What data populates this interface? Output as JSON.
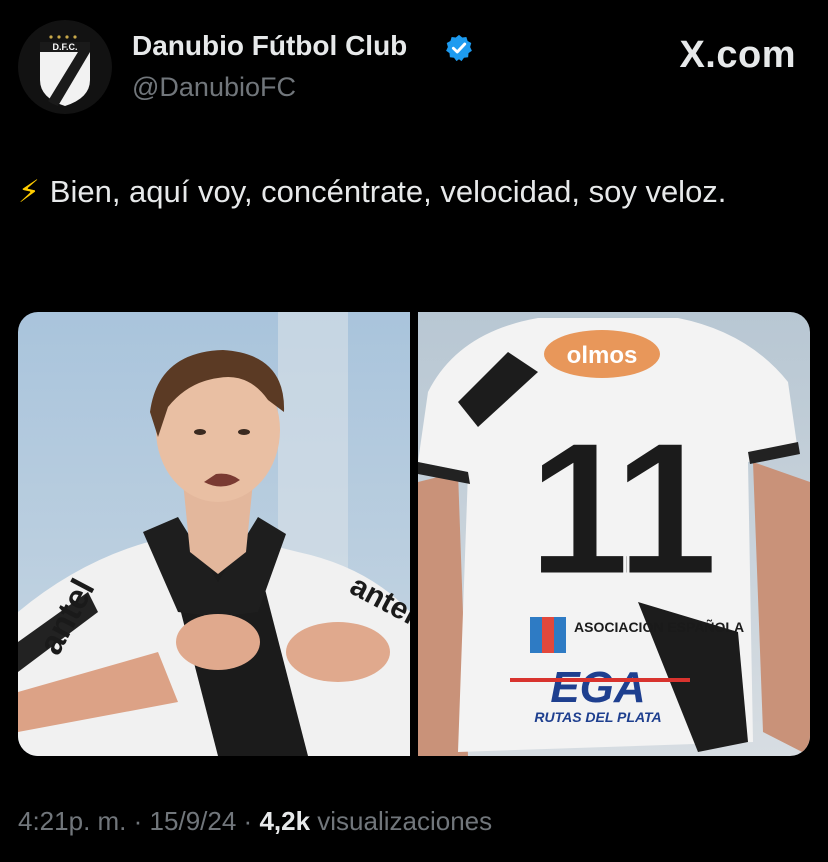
{
  "account": {
    "display_name": "Danubio Fútbol Club",
    "handle": "@DanubioFC",
    "avatar_text": "D.F.C.",
    "verified_icon": "verified-badge-icon"
  },
  "site": {
    "logo_text": "X.com"
  },
  "tweet": {
    "emoji": "⚡",
    "text": "Bien, aquí voy, concéntrate, velocidad, soy veloz.",
    "images": [
      {
        "label": "player-celebrating-photo",
        "sponsor": "antel"
      },
      {
        "label": "jersey-back-photo",
        "number": "11",
        "sponsor_top": "olmos",
        "sponsor_mid": "ASOCIACION ESPAÑOLA",
        "sponsor_bottom": "EGA",
        "sponsor_footer": "RUTAS DEL PLATA"
      }
    ]
  },
  "meta": {
    "time": "4:21p. m.",
    "separator": "·",
    "date": "15/9/24",
    "views": "4,2k",
    "views_label": "visualizaciones"
  },
  "colors": {
    "background": "#000000",
    "text_primary": "#e7e9ea",
    "text_secondary": "#71767b",
    "verified": "#1d9bf0"
  }
}
